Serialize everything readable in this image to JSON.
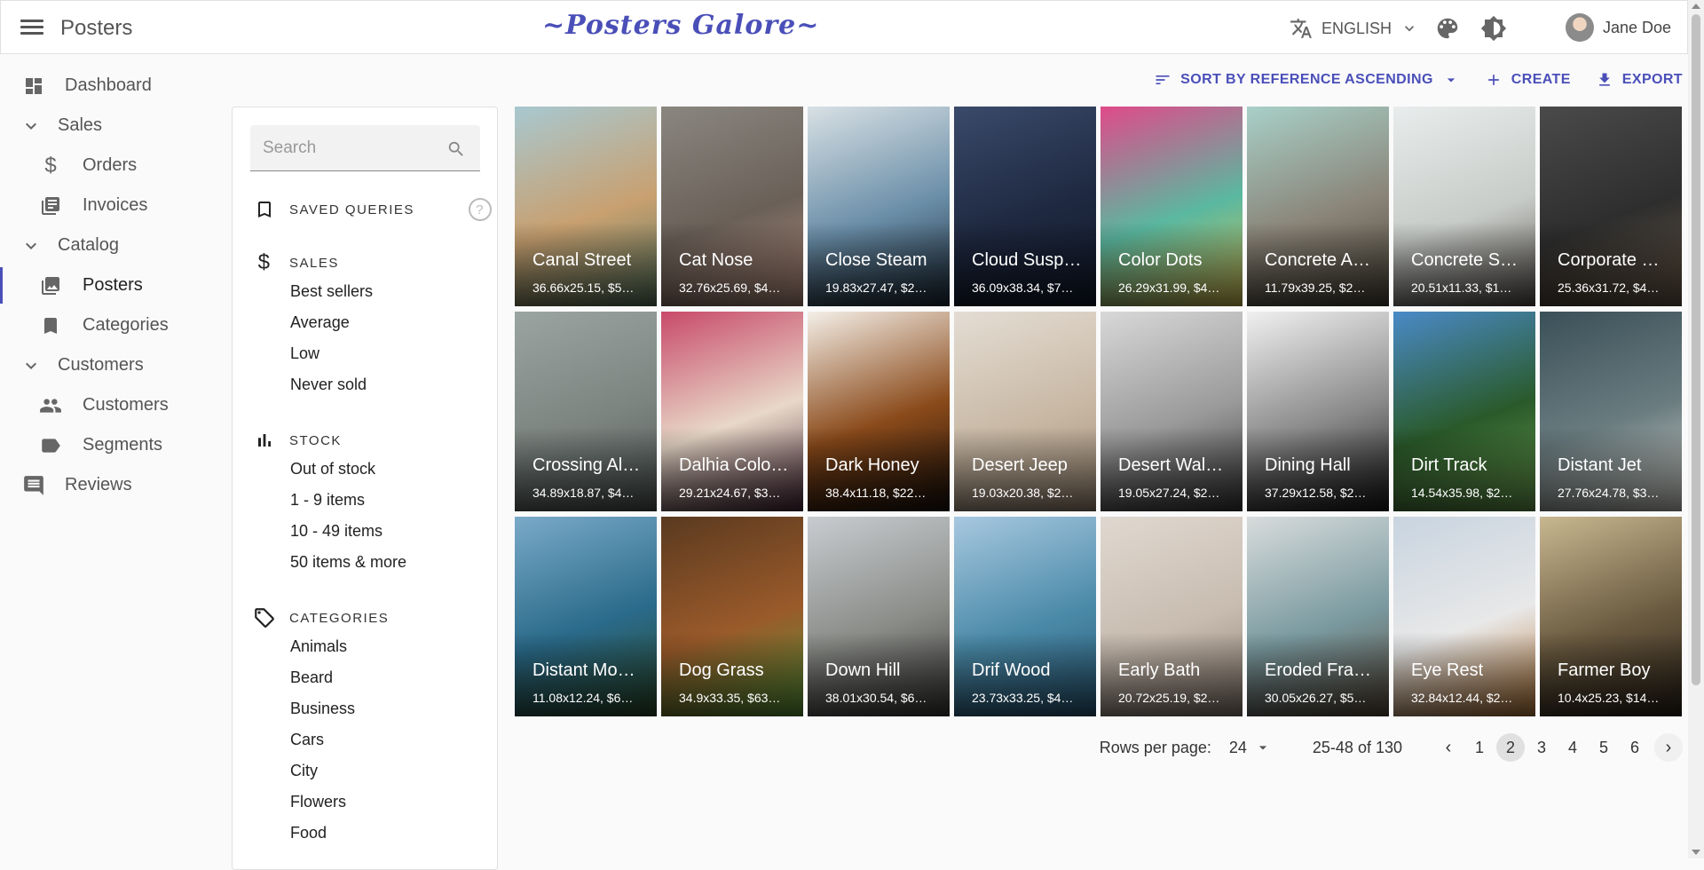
{
  "header": {
    "title": "Posters",
    "brand": "~Posters Galore~",
    "language": "ENGLISH",
    "user_name": "Jane Doe"
  },
  "sidebar": {
    "items": [
      {
        "label": "Dashboard",
        "icon": "dashboard-icon",
        "kind": "top"
      },
      {
        "label": "Sales",
        "icon": "chevron-down-icon",
        "kind": "group"
      },
      {
        "label": "Orders",
        "icon": "dollar-icon",
        "kind": "sub"
      },
      {
        "label": "Invoices",
        "icon": "invoice-icon",
        "kind": "sub"
      },
      {
        "label": "Catalog",
        "icon": "chevron-down-icon",
        "kind": "group"
      },
      {
        "label": "Posters",
        "icon": "image-icon",
        "kind": "sub",
        "active": true
      },
      {
        "label": "Categories",
        "icon": "bookmark-icon",
        "kind": "sub"
      },
      {
        "label": "Customers",
        "icon": "chevron-down-icon",
        "kind": "group"
      },
      {
        "label": "Customers",
        "icon": "people-icon",
        "kind": "sub"
      },
      {
        "label": "Segments",
        "icon": "label-icon",
        "kind": "sub"
      },
      {
        "label": "Reviews",
        "icon": "comment-icon",
        "kind": "top"
      }
    ]
  },
  "filter": {
    "search_placeholder": "Search",
    "saved_queries": "SAVED QUERIES",
    "sales": {
      "title": "SALES",
      "items": [
        "Best sellers",
        "Average",
        "Low",
        "Never sold"
      ]
    },
    "stock": {
      "title": "STOCK",
      "items": [
        "Out of stock",
        "1 - 9 items",
        "10 - 49 items",
        "50 items & more"
      ]
    },
    "categories": {
      "title": "CATEGORIES",
      "items": [
        "Animals",
        "Beard",
        "Business",
        "Cars",
        "City",
        "Flowers",
        "Food"
      ]
    }
  },
  "toolbar": {
    "sort_label": "SORT BY REFERENCE ASCENDING",
    "create_label": "CREATE",
    "export_label": "EXPORT"
  },
  "posters": [
    {
      "name": "Canal Street",
      "meta": "36.66x25.15, $5…",
      "colors": [
        "#a8c8d0",
        "#c8a070",
        "#5a7860"
      ]
    },
    {
      "name": "Cat Nose",
      "meta": "32.76x25.69, $4…",
      "colors": [
        "#8a8680",
        "#6a6058",
        "#b89080"
      ]
    },
    {
      "name": "Close Steam",
      "meta": "19.83x27.47, $2…",
      "colors": [
        "#d8e0e4",
        "#6a8ea8",
        "#1c2a38"
      ]
    },
    {
      "name": "Cloud Susp…",
      "meta": "36.09x38.34, $7…",
      "colors": [
        "#3a4a6a",
        "#1e2840",
        "#101828"
      ]
    },
    {
      "name": "Color Dots",
      "meta": "26.29x31.99, $4…",
      "colors": [
        "#e04a8a",
        "#5ab8a0",
        "#d8c050"
      ]
    },
    {
      "name": "Concrete A…",
      "meta": "11.79x39.25, $2…",
      "colors": [
        "#a8d0c8",
        "#8a8478",
        "#4a4438"
      ]
    },
    {
      "name": "Concrete S…",
      "meta": "20.51x11.33, $1…",
      "colors": [
        "#e8ecec",
        "#c8ccc8",
        "#5a5450"
      ]
    },
    {
      "name": "Corporate …",
      "meta": "25.36x31.72, $4…",
      "colors": [
        "#4a4a4a",
        "#2e2e2e",
        "#6a5a48"
      ]
    },
    {
      "name": "Crossing Al…",
      "meta": "34.89x18.87, $4…",
      "colors": [
        "#9aa4a0",
        "#7c8480",
        "#4e5654"
      ]
    },
    {
      "name": "Dalhia Colo…",
      "meta": "29.21x24.67, $3…",
      "colors": [
        "#c84a6a",
        "#e8d8c8",
        "#4a2a3a"
      ]
    },
    {
      "name": "Dark Honey",
      "meta": "38.4x11.18, $22…",
      "colors": [
        "#f4efe8",
        "#8a4a1a",
        "#1a100a"
      ]
    },
    {
      "name": "Desert Jeep",
      "meta": "19.03x20.38, $2…",
      "colors": [
        "#e4ddd4",
        "#c8b8a4",
        "#a08c78"
      ]
    },
    {
      "name": "Desert Wal…",
      "meta": "19.05x27.24, $2…",
      "colors": [
        "#d8d8d8",
        "#9a9a9a",
        "#3a3a3a"
      ]
    },
    {
      "name": "Dining Hall",
      "meta": "37.29x12.58, $2…",
      "colors": [
        "#f0f0f0",
        "#8a8a8a",
        "#1a1a1a"
      ]
    },
    {
      "name": "Dirt Track",
      "meta": "14.54x35.98, $2…",
      "colors": [
        "#4a8ac8",
        "#2a5a2a",
        "#6aa050"
      ]
    },
    {
      "name": "Distant Jet",
      "meta": "27.76x24.78, $3…",
      "colors": [
        "#3a5058",
        "#6a7c80",
        "#d8d8d0"
      ]
    },
    {
      "name": "Distant Mo…",
      "meta": "11.08x12.24, $6…",
      "colors": [
        "#7aaac8",
        "#2a6a8a",
        "#2a4a2a"
      ]
    },
    {
      "name": "Dog Grass",
      "meta": "34.9x33.35, $63…",
      "colors": [
        "#5a3a20",
        "#9a5a2a",
        "#5a9a3a"
      ]
    },
    {
      "name": "Down Hill",
      "meta": "38.01x30.54, $6…",
      "colors": [
        "#c8ccd0",
        "#8a8c88",
        "#3a3a38"
      ]
    },
    {
      "name": "Drif Wood",
      "meta": "23.73x33.25, $4…",
      "colors": [
        "#a8c8e0",
        "#4a8aa8",
        "#2a5a78"
      ]
    },
    {
      "name": "Early Bath",
      "meta": "20.72x25.19, $2…",
      "colors": [
        "#e0d8d0",
        "#c8bcb0",
        "#8a7c70"
      ]
    },
    {
      "name": "Eroded Fra…",
      "meta": "30.05x26.27, $5…",
      "colors": [
        "#d8dcdc",
        "#7a9aa0",
        "#5a4a3a"
      ]
    },
    {
      "name": "Eye Rest",
      "meta": "32.84x12.44, $2…",
      "colors": [
        "#c8d4e0",
        "#e8e8e8",
        "#b87838"
      ]
    },
    {
      "name": "Farmer Boy",
      "meta": "10.4x25.23, $14…",
      "colors": [
        "#c8b890",
        "#6a5a40",
        "#2a2218"
      ]
    }
  ],
  "pagination": {
    "rows_label": "Rows per page:",
    "rows_value": "24",
    "range": "25-48 of 130",
    "pages": [
      "1",
      "2",
      "3",
      "4",
      "5",
      "6"
    ],
    "current": "2"
  },
  "colors": {
    "accent": "#4a4fb8"
  }
}
